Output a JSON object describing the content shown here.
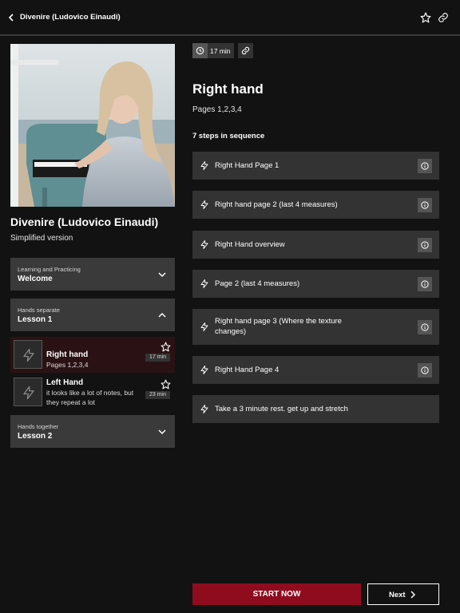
{
  "header": {
    "title": "Divenire (Ludovico Einaudi)"
  },
  "song": {
    "title": "Divenire (Ludovico Einaudi)",
    "subtitle": "Simplified version"
  },
  "sections": [
    {
      "category": "Learning and Practicing",
      "name": "Welcome",
      "expanded": false
    },
    {
      "category": "Hands separate",
      "name": "Lesson 1",
      "expanded": true
    },
    {
      "category": "Hands together",
      "name": "Lesson 2",
      "expanded": false
    }
  ],
  "lessons": [
    {
      "name": "Right hand",
      "description": "Pages 1,2,3,4",
      "duration": "17 min",
      "active": true
    },
    {
      "name": "Left Hand",
      "description": "it looks like a lot of notes, but they repeat a lot",
      "duration": "23 min",
      "active": false
    }
  ],
  "detail": {
    "duration": "17 min",
    "title": "Right hand",
    "pages": "Pages 1,2,3,4",
    "steps_label": "7 steps in sequence",
    "steps": [
      {
        "label": "Right Hand Page 1",
        "has_info": true
      },
      {
        "label": "Right hand page 2 (last 4 measures)",
        "has_info": true
      },
      {
        "label": "Right Hand overview",
        "has_info": true
      },
      {
        "label": "Page 2 (last 4 measures)",
        "has_info": true
      },
      {
        "label": "Right hand page 3 (Where the texture changes)",
        "has_info": true
      },
      {
        "label": "Right Hand Page 4",
        "has_info": true
      },
      {
        "label": "Take a 3 minute rest. get up and stretch",
        "has_info": false
      }
    ]
  },
  "actions": {
    "start": "START NOW",
    "next": "Next"
  },
  "colors": {
    "accent": "#8e0c1e",
    "background": "#121212",
    "card": "#333333"
  }
}
